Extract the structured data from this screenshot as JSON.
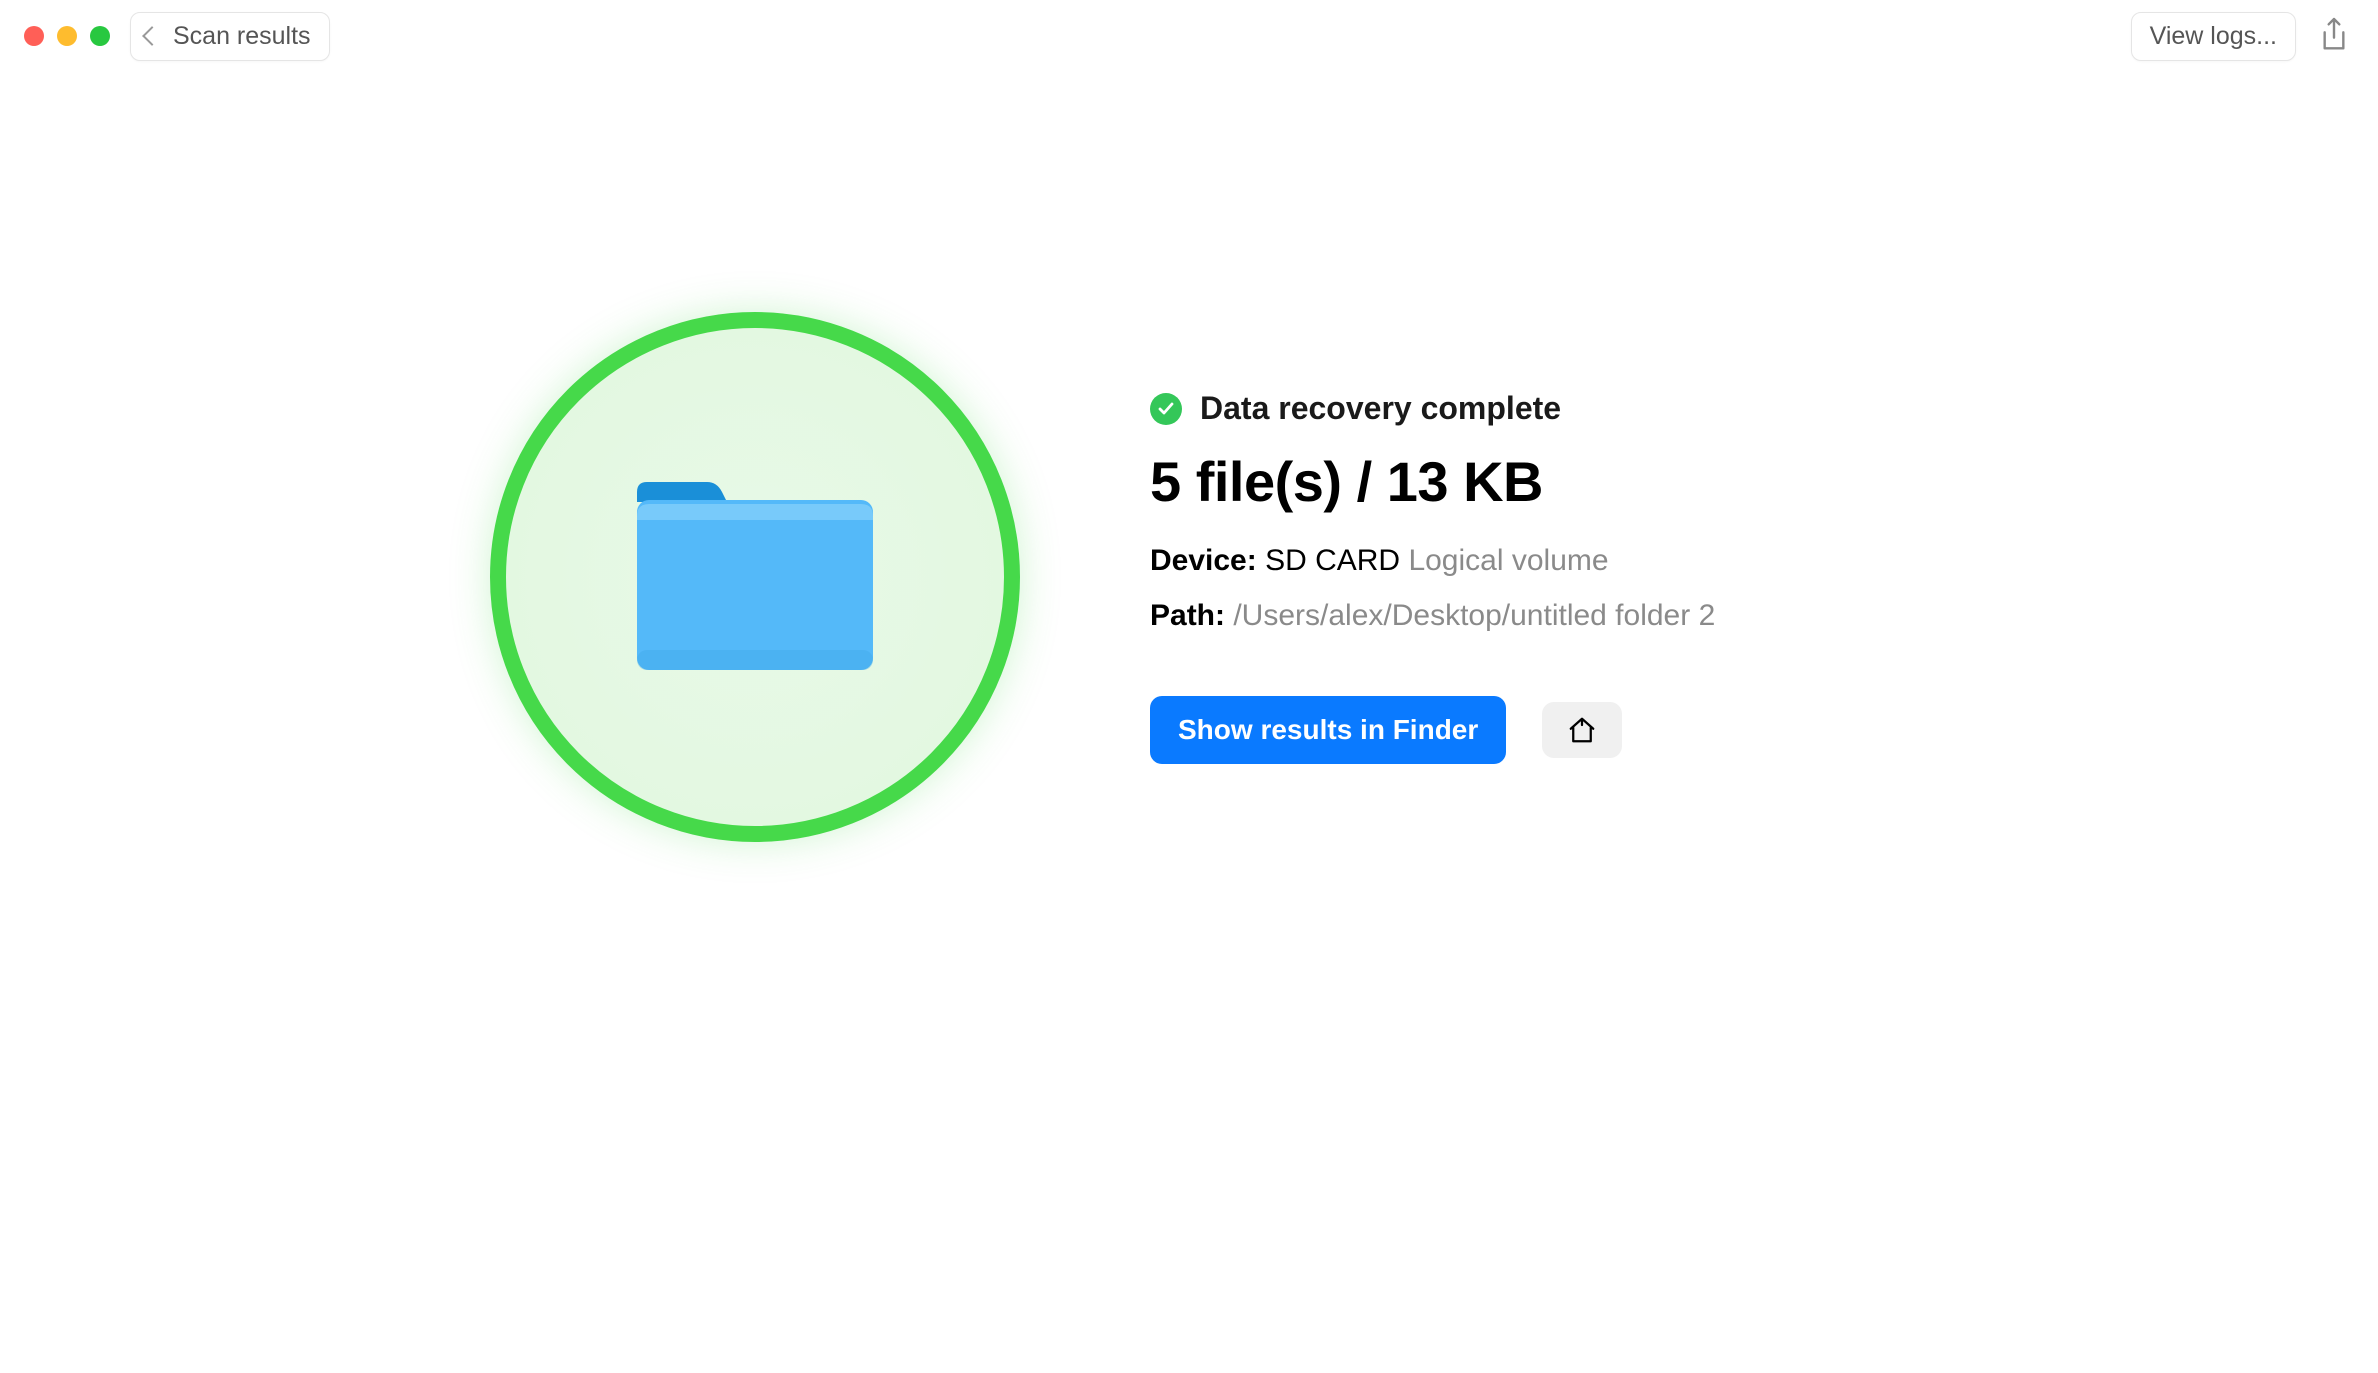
{
  "titlebar": {
    "back_label": "Scan results",
    "view_logs_label": "View logs..."
  },
  "status": {
    "message": "Data recovery complete"
  },
  "summary": {
    "files_size": "5 file(s) / 13 KB"
  },
  "details": {
    "device_label": "Device:",
    "device_name": "SD CARD",
    "device_type": "Logical volume",
    "path_label": "Path:",
    "path_value": "/Users/alex/Desktop/untitled folder 2"
  },
  "actions": {
    "show_results_label": "Show results in Finder"
  }
}
